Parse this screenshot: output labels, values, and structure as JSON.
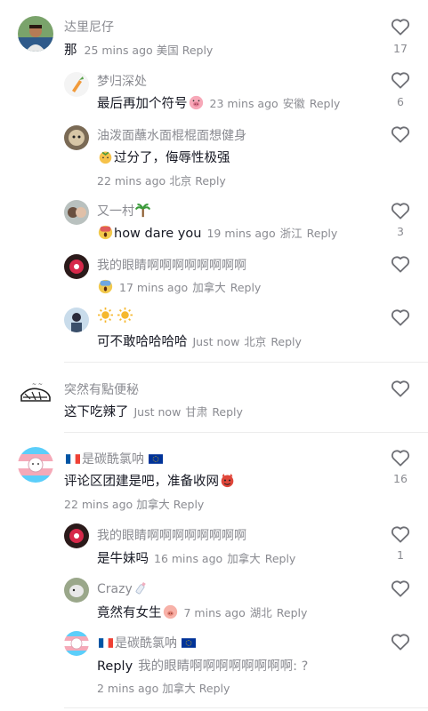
{
  "comments": [
    {
      "name": "达里尼仔",
      "text": "那",
      "time": "25 mins ago",
      "location": "美国",
      "reply": "Reply",
      "likes": "17"
    },
    {
      "name": "梦归深处",
      "text": "最后再加个符号",
      "time": "23 mins ago",
      "location": "安徽",
      "reply": "Reply",
      "likes": "6"
    },
    {
      "name": "油泼面蘸水面棍棍面想健身",
      "text": "过分了，侮辱性极强",
      "time": "22 mins ago",
      "location": "北京",
      "reply": "Reply",
      "likes": ""
    },
    {
      "name": "又一村",
      "text": "how dare you",
      "time": "19 mins ago",
      "location": "浙江",
      "reply": "Reply",
      "likes": "3"
    },
    {
      "name": "我的眼睛啊啊啊啊啊啊啊啊",
      "text": "",
      "time": "17 mins ago",
      "location": "加拿大",
      "reply": "Reply",
      "likes": ""
    },
    {
      "name": "",
      "text": "可不敢哈哈哈哈",
      "time": "Just now",
      "location": "北京",
      "reply": "Reply",
      "likes": ""
    },
    {
      "name": "突然有點便秘",
      "text": "这下吃辣了",
      "time": "Just now",
      "location": "甘肃",
      "reply": "Reply",
      "likes": ""
    },
    {
      "name": "是碳酰氯呐",
      "text": "评论区团建是吧，准备收网",
      "time": "22 mins ago",
      "location": "加拿大",
      "reply": "Reply",
      "likes": "16"
    },
    {
      "name": "我的眼睛啊啊啊啊啊啊啊啊",
      "text": "是牛妹吗",
      "time": "16 mins ago",
      "location": "加拿大",
      "reply": "Reply",
      "likes": "1"
    },
    {
      "name": "Crazy",
      "text": "竟然有女生",
      "time": "7 mins ago",
      "location": "湖北",
      "reply": "Reply",
      "likes": ""
    },
    {
      "name": "是碳酰氯呐",
      "text_prefix": "Reply",
      "text": "我的眼睛啊啊啊啊啊啊啊啊: ?",
      "time": "2 mins ago",
      "location": "加拿大",
      "reply": "Reply",
      "likes": ""
    }
  ],
  "colors": {
    "text": "#161823",
    "secondary": "#8a8b91",
    "divider": "#ececec"
  }
}
